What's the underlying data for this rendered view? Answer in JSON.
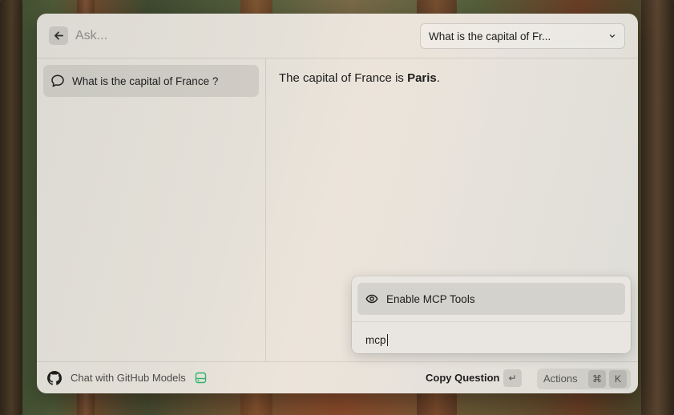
{
  "search": {
    "placeholder": "Ask...",
    "value": ""
  },
  "conversation_select": {
    "selected": "What is the capital of Fr..."
  },
  "sidebar": {
    "items": [
      {
        "label": "What is the capital of France ?"
      }
    ]
  },
  "answer": {
    "prefix": "The capital of France is ",
    "bold": "Paris",
    "suffix": "."
  },
  "action_popup": {
    "items": [
      {
        "label": "Enable MCP Tools",
        "icon": "eye-icon"
      }
    ],
    "filter_value": "mcp"
  },
  "footer": {
    "model_label": "Chat with GitHub Models",
    "primary_action": "Copy Question",
    "primary_key": "↵",
    "actions_label": "Actions",
    "actions_keys": [
      "⌘",
      "K"
    ]
  },
  "colors": {
    "server_icon": "#2fb36b"
  }
}
